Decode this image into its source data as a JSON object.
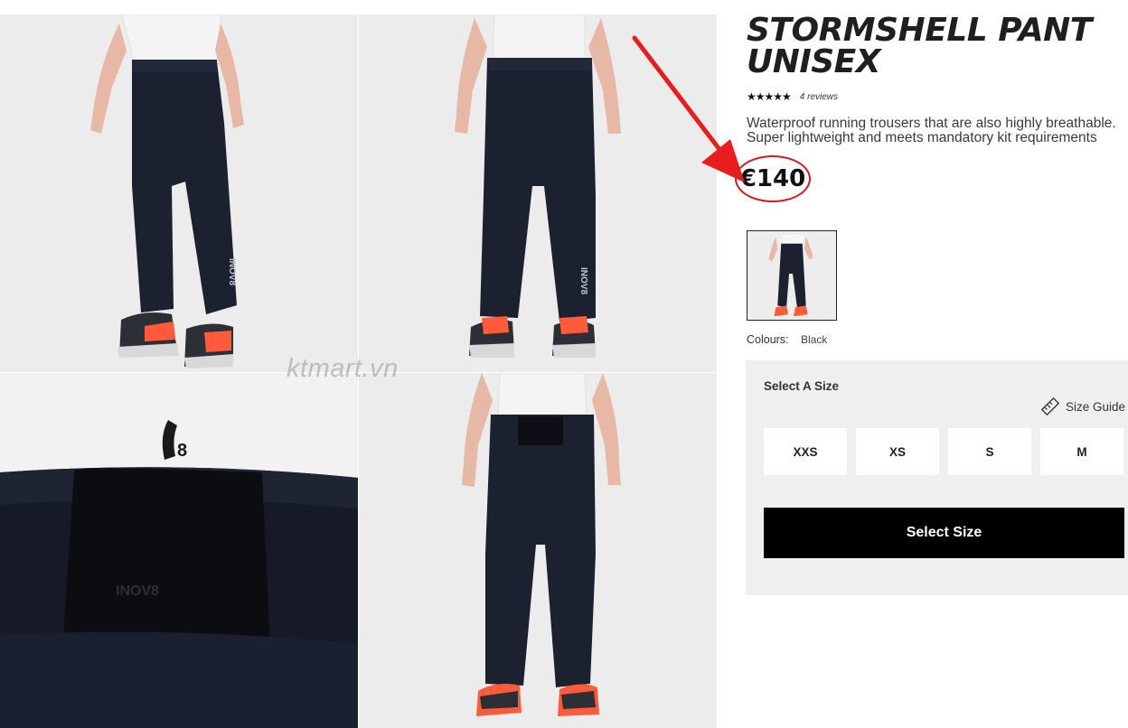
{
  "watermark": "ktmart.vn",
  "product": {
    "title": "STORMSHELL PANT UNISEX",
    "stars": "★★★★★",
    "reviews": "4 reviews",
    "description": "Waterproof running trousers that are also highly breathable. Super lightweight and meets mandatory kit requirements",
    "price": "€140",
    "colours_label": "Colours:",
    "colour_value": "Black"
  },
  "size_panel": {
    "label": "Select A Size",
    "guide": "Size Guide",
    "sizes": [
      "XXS",
      "XS",
      "S",
      "M"
    ],
    "cta": "Select Size"
  },
  "gallery": {
    "logo_text": "INOV8"
  },
  "colors": {
    "accent_red": "#d61a1a",
    "cta_bg": "#000000",
    "panel_bg": "#efefef",
    "photo_bg": "#ececec",
    "trouser": "#1c2130",
    "shoe_orange": "#ff5a3c"
  }
}
